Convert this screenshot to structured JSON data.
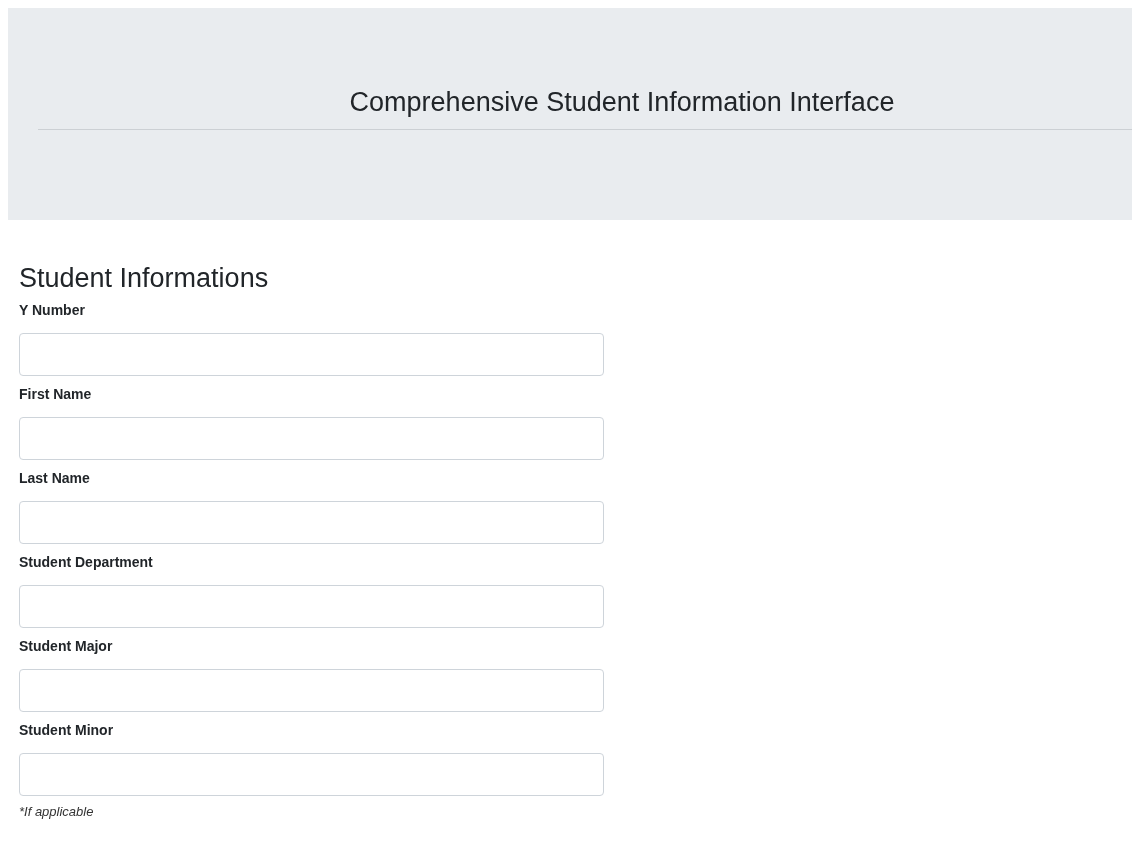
{
  "header": {
    "title": "Comprehensive Student Information Interface"
  },
  "form": {
    "heading": "Student Informations",
    "fields": [
      {
        "label": "Y Number"
      },
      {
        "label": "First Name"
      },
      {
        "label": "Last Name"
      },
      {
        "label": "Student Department"
      },
      {
        "label": "Student Major"
      },
      {
        "label": "Student Minor",
        "note": "*If applicable"
      }
    ]
  }
}
